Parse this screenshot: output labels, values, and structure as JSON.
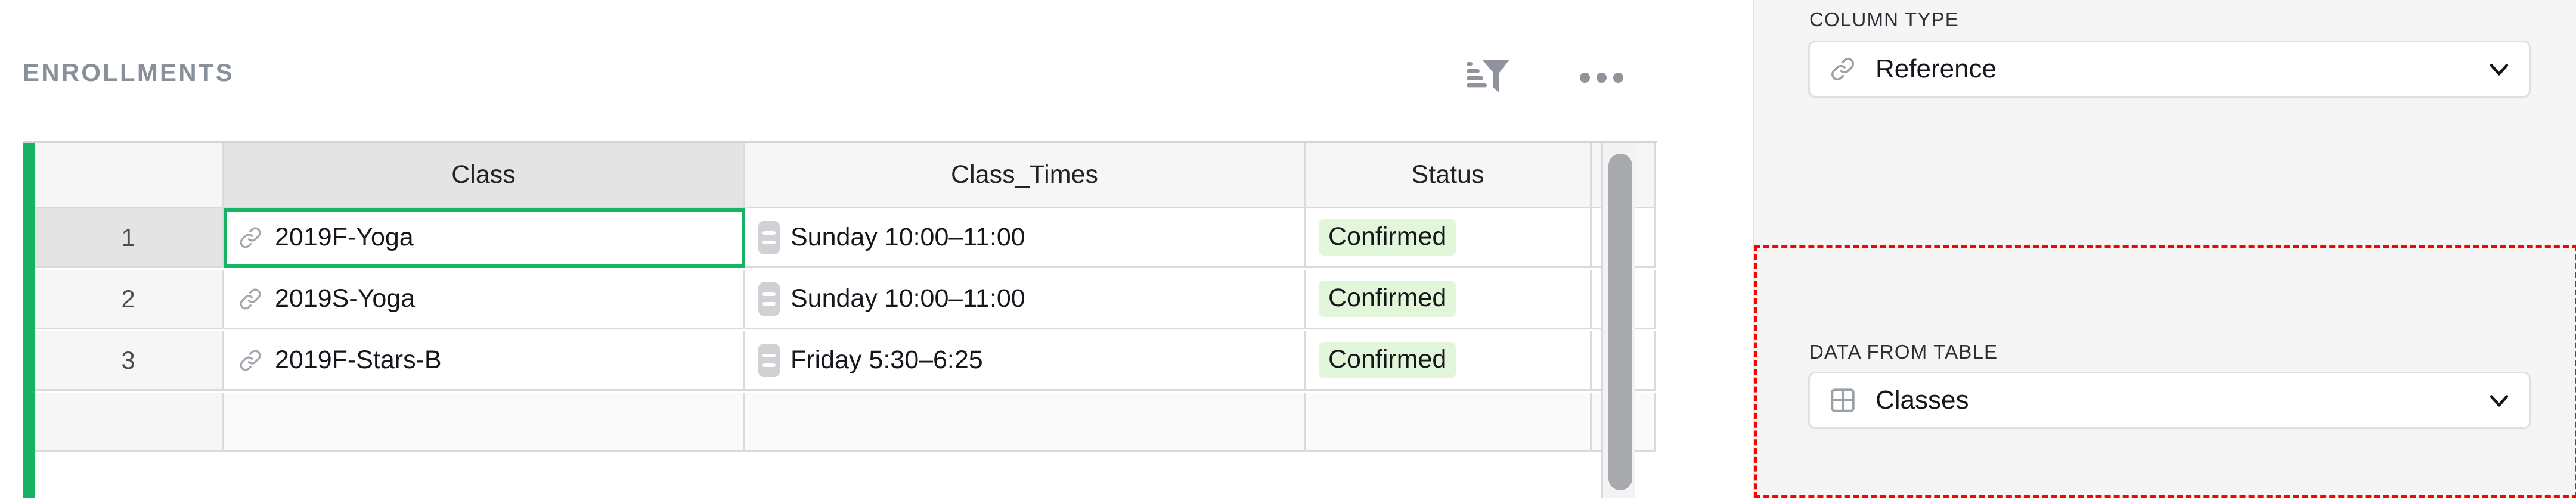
{
  "widget": {
    "title": "ENROLLMENTS",
    "sort_filter_icon": "sort-filter-icon",
    "menu_icon": "more-options-icon"
  },
  "grid": {
    "columns": [
      {
        "key": "rownum",
        "label": "",
        "active": false
      },
      {
        "key": "class",
        "label": "Class",
        "active": true
      },
      {
        "key": "class_times",
        "label": "Class_Times",
        "active": false
      },
      {
        "key": "status",
        "label": "Status",
        "active": false
      },
      {
        "key": "extra",
        "label": "",
        "active": false
      }
    ],
    "rows": [
      {
        "num": "1",
        "class": "2019F-Yoga",
        "class_times": "Sunday 10:00–11:00",
        "status": "Confirmed",
        "selected": true
      },
      {
        "num": "2",
        "class": "2019S-Yoga",
        "class_times": "Sunday 10:00–11:00",
        "status": "Confirmed",
        "selected": false
      },
      {
        "num": "3",
        "class": "2019F-Stars-B",
        "class_times": "Friday 5:30–6:25",
        "status": "Confirmed",
        "selected": false
      }
    ],
    "icons": {
      "reference": "link-icon",
      "choice": "choice-list-icon"
    },
    "colors": {
      "selection": "#16b364",
      "status_pill_bg": "#e2f6da",
      "active_header_bg": "#e4e4e4",
      "scrollbar_thumb": "#a7a9ad"
    }
  },
  "panel": {
    "column_type": {
      "label": "COLUMN TYPE",
      "value": "Reference",
      "icon": "link-icon",
      "chevron": "chevron-down-icon"
    },
    "data_from_table": {
      "label": "DATA FROM TABLE",
      "value": "Classes",
      "icon": "table-grid-icon",
      "chevron": "chevron-down-icon",
      "highlight_color": "#ff0000"
    }
  }
}
